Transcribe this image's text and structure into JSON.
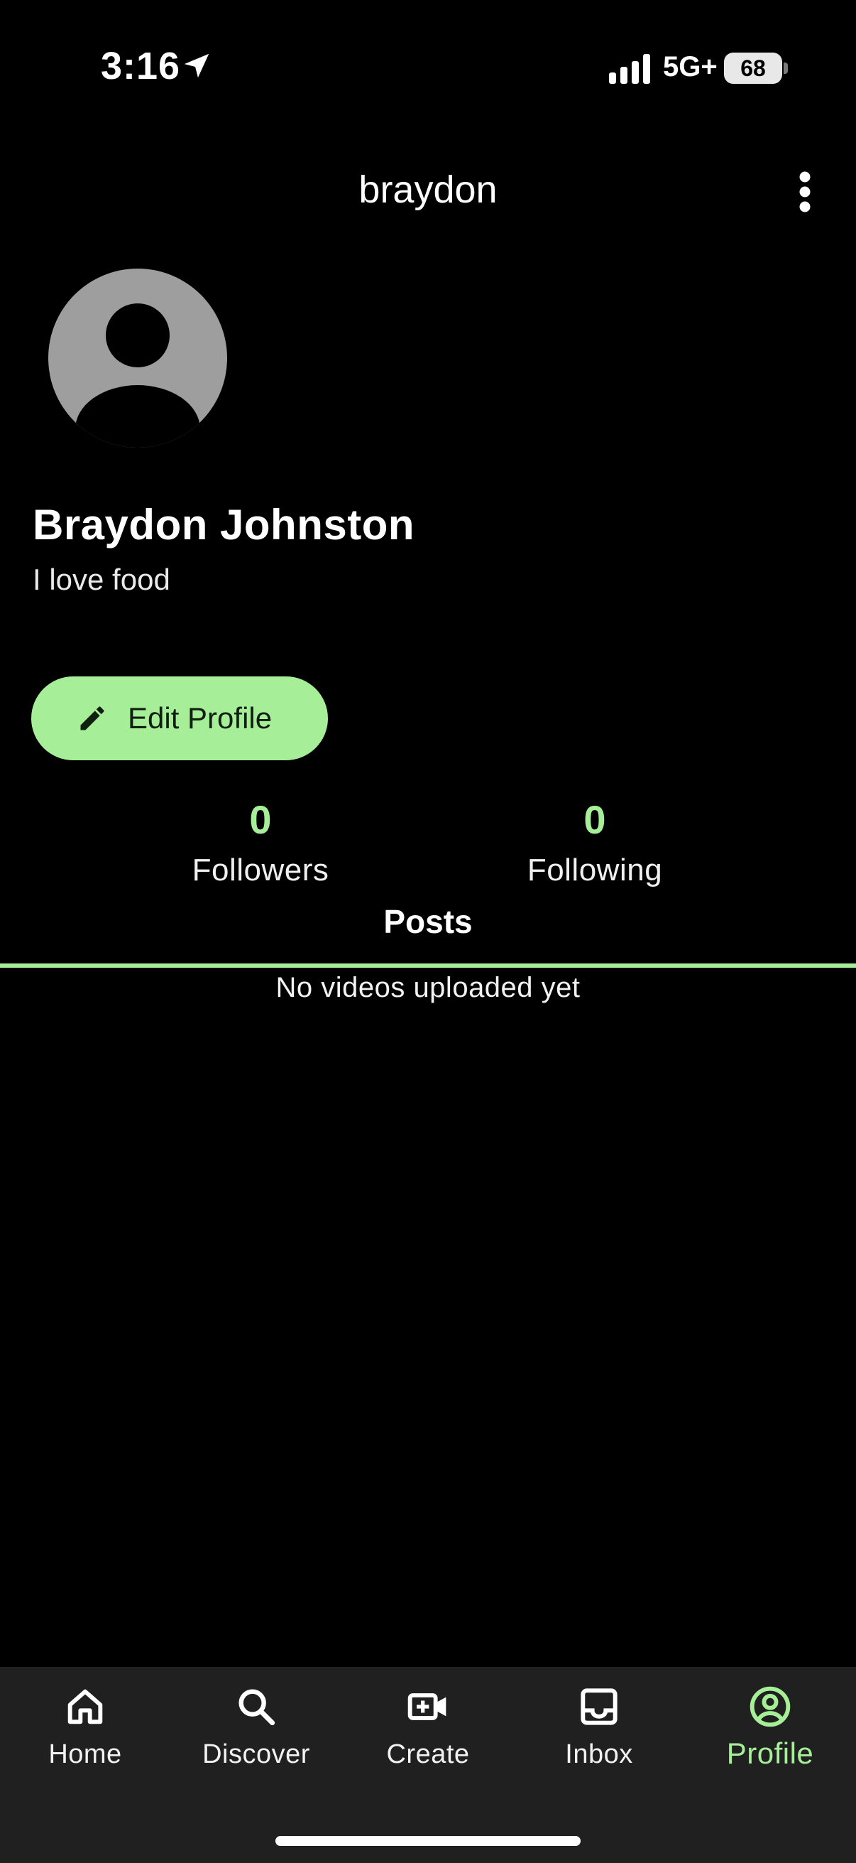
{
  "status_bar": {
    "time": "3:16",
    "network": "5G+",
    "battery": "68",
    "icons": [
      "location-arrow-icon",
      "signal-icon",
      "battery-icon"
    ]
  },
  "header": {
    "title": "braydon",
    "menu_icon": "more-vertical-icon"
  },
  "profile": {
    "avatar_icon": "default-avatar-icon",
    "name": "Braydon Johnston",
    "bio": "I love food",
    "edit_button": "Edit Profile"
  },
  "stats": {
    "followers_count": "0",
    "followers_label": "Followers",
    "following_count": "0",
    "following_label": "Following"
  },
  "tabs": {
    "posts": "Posts"
  },
  "content": {
    "empty_message": "No videos uploaded yet"
  },
  "bottom_nav": {
    "items": [
      {
        "label": "Home",
        "icon": "home-icon"
      },
      {
        "label": "Discover",
        "icon": "search-icon"
      },
      {
        "label": "Create",
        "icon": "video-add-icon"
      },
      {
        "label": "Inbox",
        "icon": "inbox-icon"
      },
      {
        "label": "Profile",
        "icon": "profile-icon"
      }
    ],
    "active": "Profile"
  },
  "colors": {
    "accent": "#a6ef98",
    "background": "#000000",
    "nav_background": "#202020",
    "avatar_gray": "#9e9e9e"
  }
}
